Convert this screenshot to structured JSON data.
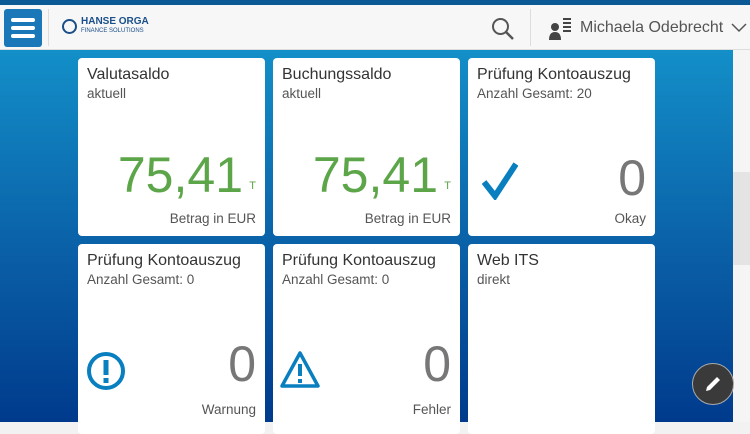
{
  "header": {
    "logo_line1": "HANSE ORGA",
    "logo_line2": "FINANCE SOLUTIONS",
    "user_name": "Michaela Odebrecht"
  },
  "tiles": [
    {
      "title": "Valutasaldo",
      "subtitle": "aktuell",
      "value": "75,41",
      "unit": "T",
      "footer": "Betrag in EUR"
    },
    {
      "title": "Buchungssaldo",
      "subtitle": "aktuell",
      "value": "75,41",
      "unit": "T",
      "footer": "Betrag in EUR"
    },
    {
      "title": "Prüfung Kontoauszug",
      "subtitle": "Anzahl Gesamt: 20",
      "value": "0",
      "footer": "Okay",
      "icon": "checkmark-icon"
    },
    {
      "title": "Prüfung Kontoauszug",
      "subtitle": "Anzahl Gesamt: 0",
      "value": "0",
      "footer": "Warnung",
      "icon": "exclamation-circle-icon"
    },
    {
      "title": "Prüfung Kontoauszug",
      "subtitle": "Anzahl Gesamt: 0",
      "value": "0",
      "footer": "Fehler",
      "icon": "warning-triangle-icon"
    },
    {
      "title": "Web ITS",
      "subtitle": "direkt"
    }
  ],
  "colors": {
    "accent": "#1a78b8",
    "value_green": "#5ca548",
    "icon_blue": "#0a7fc0"
  }
}
